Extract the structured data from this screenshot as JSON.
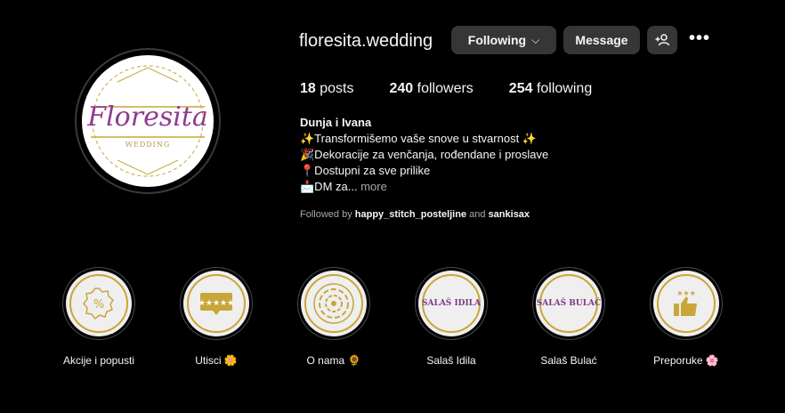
{
  "profile": {
    "avatar_logo_text": "Floresita",
    "avatar_logo_sub": "WEDDING",
    "username": "floresita.wedding",
    "buttons": {
      "following": "Following",
      "message": "Message",
      "add_user_icon": "add-user-icon",
      "more_icon": "more-icon"
    },
    "stats": [
      {
        "value": "18",
        "label": "posts"
      },
      {
        "value": "240",
        "label": "followers"
      },
      {
        "value": "254",
        "label": "following"
      }
    ],
    "bio": {
      "name": "Dunja i Ivana",
      "lines": [
        "✨Transformišemo vaše snove u stvarnost ✨",
        "🎉Dekoracije za venčanja, rođendane i proslave",
        "📍Dostupni za sve prilike",
        "📩DM za..."
      ],
      "more": "more"
    },
    "followed_by": {
      "prefix": "Followed by",
      "user1": "happy_stitch_posteljine",
      "conj": "and",
      "user2": "sankisax"
    }
  },
  "highlights": [
    {
      "label": "Akcije i popusti",
      "icon": "percent-icon",
      "text": ""
    },
    {
      "label": "Utisci 🌼",
      "icon": "rating-stars-icon",
      "text": ""
    },
    {
      "label": "O nama 🌻",
      "icon": "swirl-icon",
      "text": ""
    },
    {
      "label": "Salaš Idila",
      "icon": "",
      "text": "SALAŠ IDILA"
    },
    {
      "label": "Salaš Bulać",
      "icon": "",
      "text": "SALAŠ BULAĆ"
    },
    {
      "label": "Preporuke 🌸",
      "icon": "thumbs-up-icon",
      "text": ""
    }
  ],
  "colors": {
    "accent_gold": "#c9a63a",
    "brand_purple": "#8f3a90",
    "button_bg": "#363636"
  }
}
